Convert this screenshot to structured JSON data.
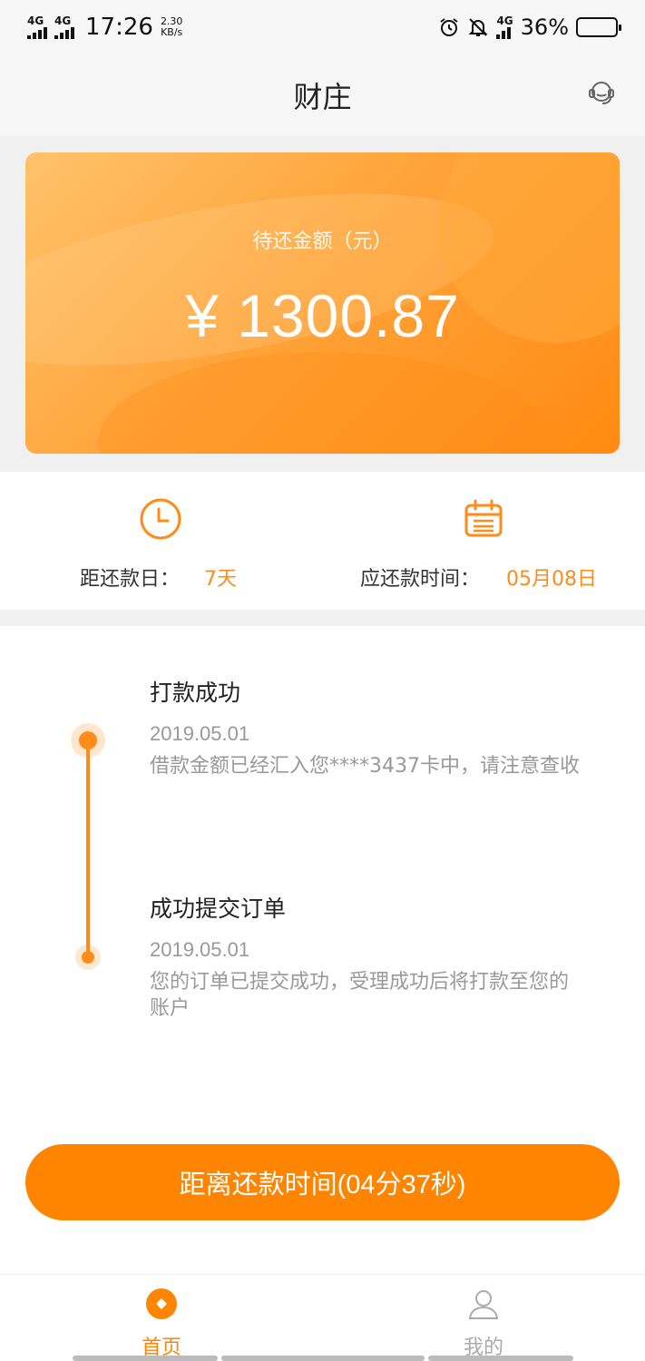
{
  "status_bar": {
    "network_1": "4G",
    "network_2": "4G",
    "time": "17:26",
    "speed_value": "2.30",
    "speed_unit": "KB/s",
    "network_3": "4G",
    "battery": "36%",
    "battery_level": 0.36,
    "icons": [
      "alarm-icon",
      "bell-muted-icon",
      "signal-icon",
      "battery-icon"
    ]
  },
  "header": {
    "title": "财庄",
    "service_icon": "customer-service-icon"
  },
  "card": {
    "label": "待还金额（元）",
    "amount": "¥ 1300.87"
  },
  "info": {
    "days_label": "距还款日：",
    "days_value": "7天",
    "date_label": "应还款时间：",
    "date_value": "05月08日",
    "icons": [
      "clock-icon",
      "calendar-icon"
    ]
  },
  "timeline": {
    "items": [
      {
        "title": "打款成功",
        "date": "2019.05.01",
        "desc": "借款金额已经汇入您****3437卡中，请注意查收"
      },
      {
        "title": "成功提交订单",
        "date": "2019.05.01",
        "desc": "您的订单已提交成功，受理成功后将打款至您的账户"
      }
    ]
  },
  "cta": {
    "label": "距离还款时间(04分37秒)"
  },
  "tabbar": {
    "items": [
      {
        "label": "首页",
        "icon": "home-icon",
        "active": true
      },
      {
        "label": "我的",
        "icon": "user-icon",
        "active": false
      }
    ]
  },
  "colors": {
    "accent": "#ff8400",
    "accent_text": "#ff8c1a",
    "background_band": "#f0f0f0"
  }
}
